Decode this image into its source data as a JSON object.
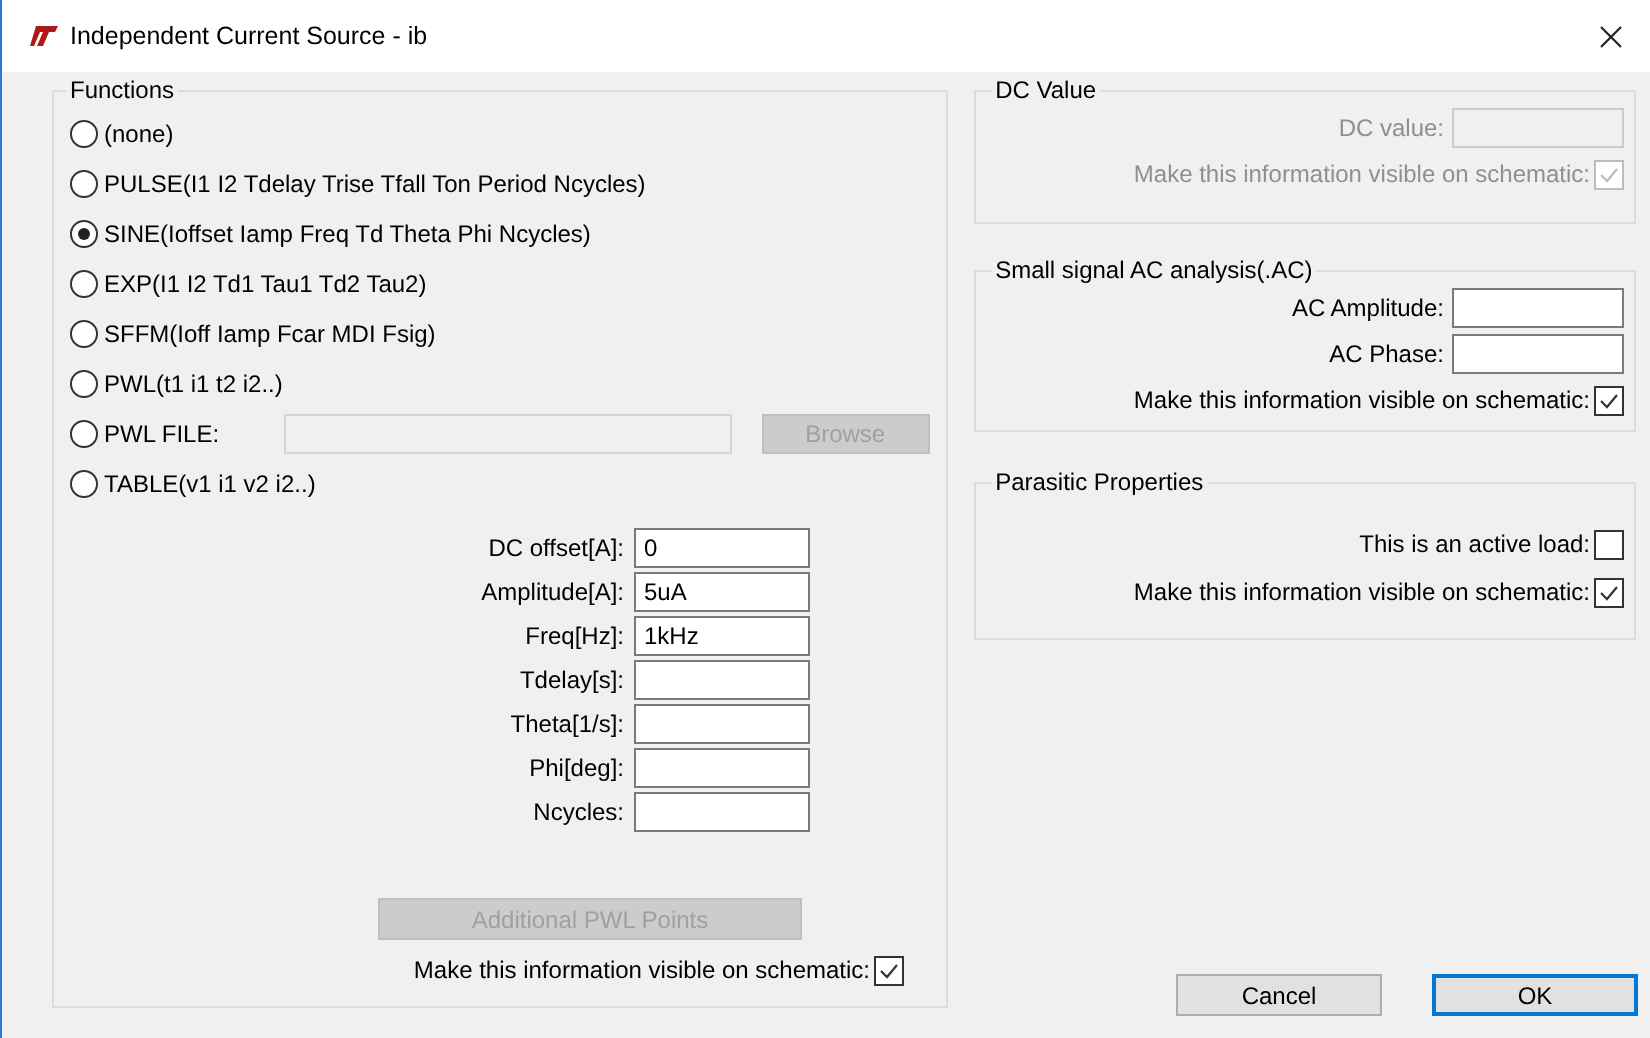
{
  "window": {
    "title": "Independent Current Source - ib"
  },
  "functions": {
    "legend": "Functions",
    "options": [
      {
        "kind": "radio",
        "label": "(none)",
        "selected": false
      },
      {
        "kind": "radio",
        "label": "PULSE(I1 I2 Tdelay Trise Tfall Ton Period Ncycles)",
        "selected": false
      },
      {
        "kind": "radio",
        "label": "SINE(Ioffset Iamp Freq Td Theta Phi Ncycles)",
        "selected": true
      },
      {
        "kind": "radio",
        "label": "EXP(I1 I2 Td1 Tau1 Td2 Tau2)",
        "selected": false
      },
      {
        "kind": "radio",
        "label": "SFFM(Ioff Iamp Fcar MDI Fsig)",
        "selected": false
      },
      {
        "kind": "radio",
        "label": "PWL(t1 i1 t2 i2..)",
        "selected": false
      },
      {
        "kind": "file",
        "label": "PWL FILE:",
        "selected": false,
        "browse": "Browse",
        "disabled": true
      },
      {
        "kind": "radio",
        "label": "TABLE(v1 i1 v2 i2..)",
        "selected": false
      }
    ],
    "params": [
      {
        "label": "DC offset[A]:",
        "value": "0"
      },
      {
        "label": "Amplitude[A]:",
        "value": "5uA"
      },
      {
        "label": "Freq[Hz]:",
        "value": "1kHz"
      },
      {
        "label": "Tdelay[s]:"
      },
      {
        "label": "Theta[1/s]:"
      },
      {
        "label": "Phi[deg]:"
      },
      {
        "label": "Ncycles:"
      }
    ],
    "pwl_button": {
      "label": "Additional PWL Points",
      "disabled": true
    },
    "visible": {
      "label": "Make this information visible on schematic:",
      "checked": true
    }
  },
  "dc_value": {
    "legend": "DC Value",
    "disabled": true,
    "field_label": "DC value:",
    "visible": {
      "label": "Make this information visible on schematic:",
      "checked": true
    }
  },
  "ac": {
    "legend": "Small signal AC analysis(.AC)",
    "fields": [
      {
        "label": "AC Amplitude:"
      },
      {
        "label": "AC Phase:"
      }
    ],
    "visible": {
      "label": "Make this information visible on schematic:",
      "checked": true
    }
  },
  "parasitic": {
    "legend": "Parasitic Properties",
    "checks": [
      {
        "label": "This is an active load:",
        "checked": false
      },
      {
        "label": "Make this information visible on schematic:",
        "checked": true
      }
    ]
  },
  "buttons": [
    {
      "label": "Cancel",
      "default": false
    },
    {
      "label": "OK",
      "default": true
    }
  ]
}
